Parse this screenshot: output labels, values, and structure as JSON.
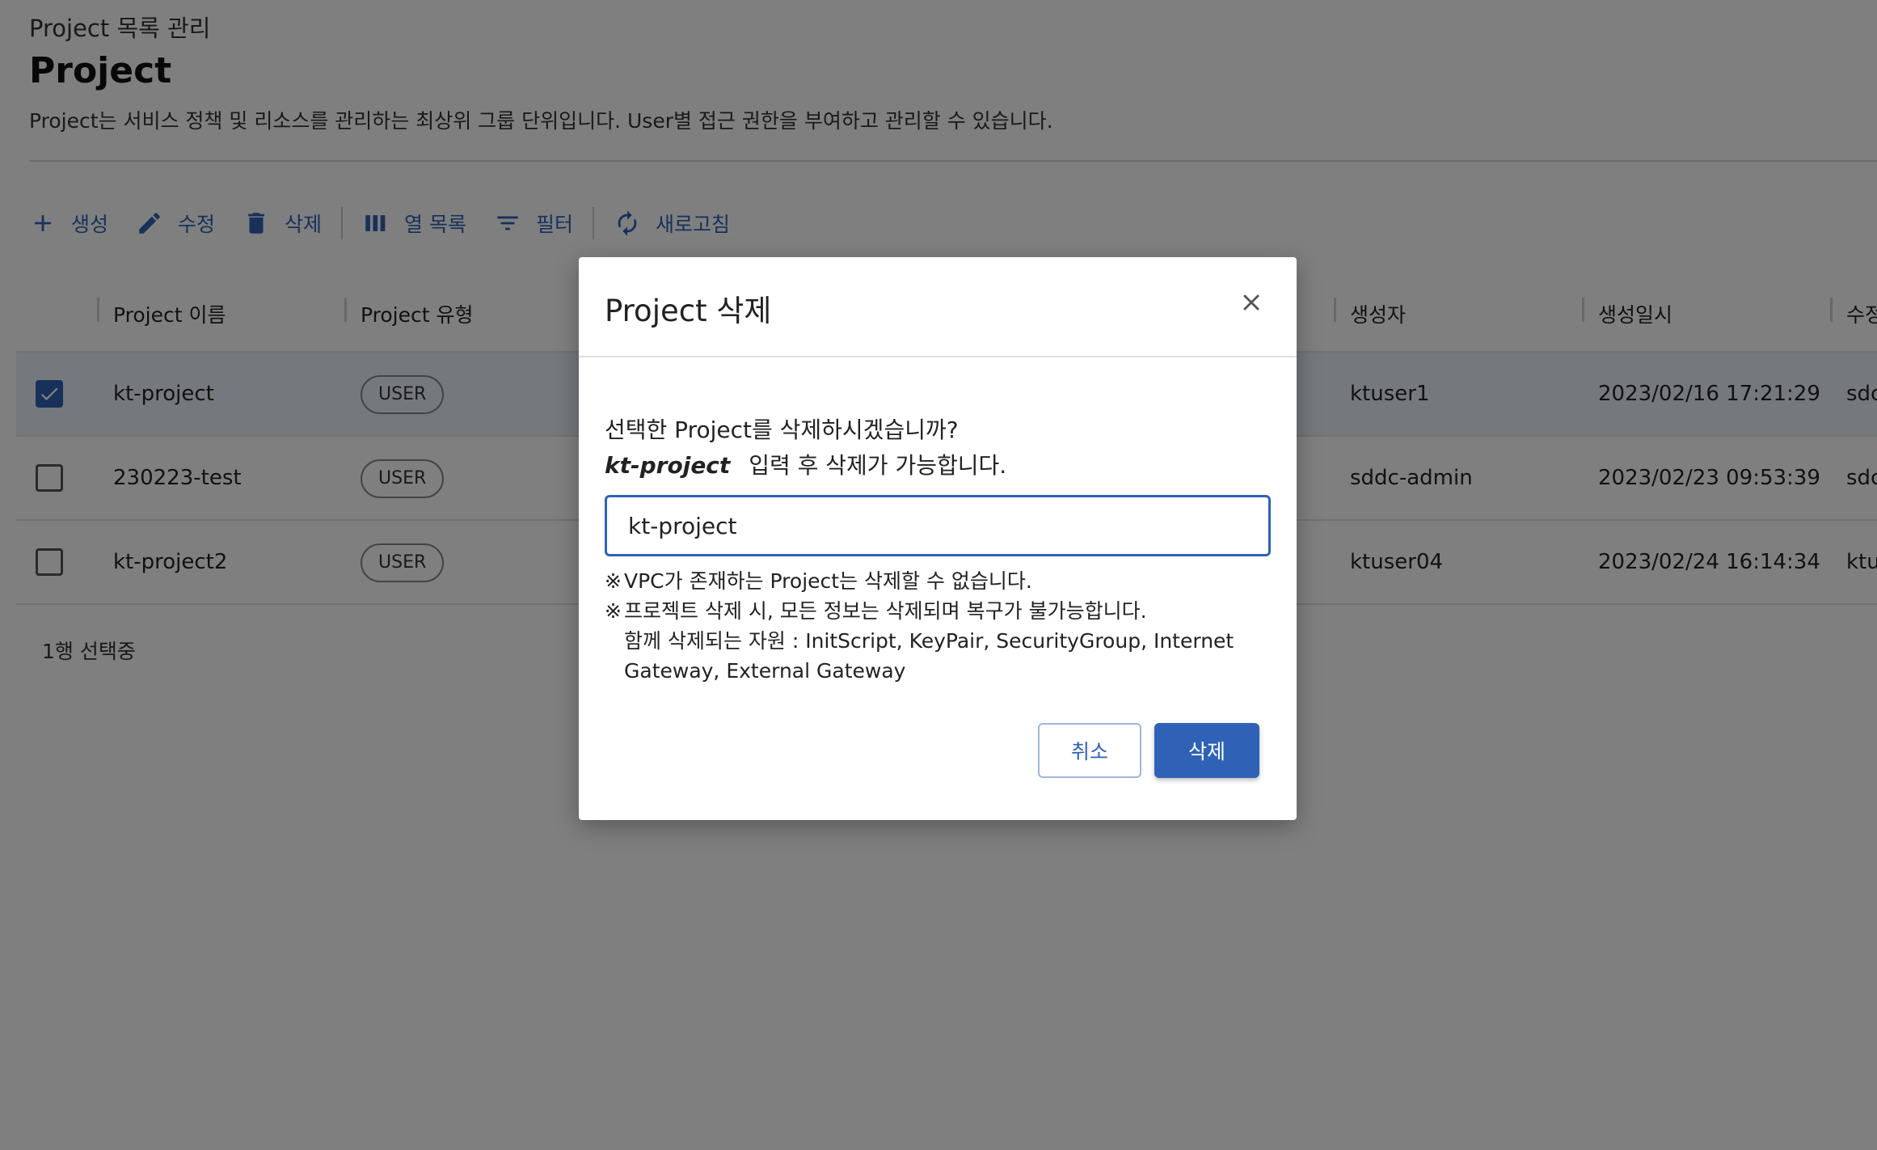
{
  "header": {
    "breadcrumb": "Project 목록 관리",
    "title": "Project",
    "description": "Project는 서비스 정책 및 리소스를 관리하는 최상위 그룹 단위입니다. User별 접근 권한을 부여하고 관리할 수 있습니다."
  },
  "toolbar": {
    "create": "생성",
    "edit": "수정",
    "delete": "삭제",
    "columns": "열 목록",
    "filter": "필터",
    "refresh": "새로고침"
  },
  "table": {
    "columns": [
      "Project 이름",
      "Project 유형",
      "생성자",
      "생성일시",
      "수정"
    ],
    "rows": [
      {
        "name": "kt-project",
        "type": "USER",
        "creator": "ktuser1",
        "created": "2023/02/16 17:21:29",
        "modifier": "sdc",
        "selected": true
      },
      {
        "name": "230223-test",
        "type": "USER",
        "creator": "sddc-admin",
        "created": "2023/02/23 09:53:39",
        "modifier": "sdc",
        "selected": false
      },
      {
        "name": "kt-project2",
        "type": "USER",
        "creator": "ktuser04",
        "created": "2023/02/24 16:14:34",
        "modifier": "ktu",
        "selected": false
      }
    ],
    "selection_count": "1행 선택중"
  },
  "modal": {
    "title": "Project 삭제",
    "question": "선택한 Project를 삭제하시겠습니까?",
    "project_name": "kt-project",
    "input_hint": "입력 후 삭제가 가능합니다.",
    "input_value": "kt-project",
    "notes": [
      "VPC가 존재하는 Project는 삭제할 수 없습니다.",
      "프로젝트 삭제 시, 모든 정보는 삭제되며 복구가 불가능합니다."
    ],
    "note_mark": "※",
    "note_detail_1": "함께 삭제되는 자원 : InitScript, KeyPair, SecurityGroup, Internet",
    "note_detail_2": "Gateway, External Gateway",
    "cancel": "취소",
    "confirm": "삭제"
  },
  "colors": {
    "accent": "#2f62b7",
    "overlay": "rgba(0,0,0,0.5)",
    "selected_row": "#ebf1fb"
  }
}
